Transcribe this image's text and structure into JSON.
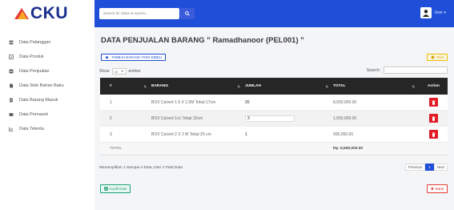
{
  "brand": {
    "logo_text": "CKU"
  },
  "topbar": {
    "search_placeholder": "Search for datas & reports...",
    "user_name": "User ▾"
  },
  "sidebar": {
    "items": [
      {
        "label": "Data Pelanggan",
        "icon": "table-icon"
      },
      {
        "label": "Data Produk",
        "icon": "box-icon"
      },
      {
        "label": "Data Penjualan",
        "icon": "cart-icon"
      },
      {
        "label": "Data Stok Bahan Baku",
        "icon": "file-icon"
      },
      {
        "label": "Data Barang Masuk",
        "icon": "inbox-icon"
      },
      {
        "label": "Data Pemasok",
        "icon": "truck-icon"
      },
      {
        "label": "Data Telenta",
        "icon": "chart-icon"
      }
    ]
  },
  "main": {
    "title": "DATA PENJUALAN BARANG \" Ramadhanoor (PEL001) \"",
    "add_button": "TAMBAH BARANG YANG DIBELI",
    "print_button": "Print",
    "show_label": "Show",
    "entries_value": "10",
    "entries_label": "entries",
    "search_label": "Search:",
    "columns": [
      "#",
      "BARANG",
      "JUMLAH",
      "TOTAL",
      "Action"
    ],
    "rows": [
      {
        "no": "1",
        "barang": "BOX Culvert 1.5 X 1.5M Tebal 17cm",
        "jumlah": "20",
        "total": "8,000,000.00"
      },
      {
        "no": "2",
        "barang": "BOX Culvert 1x1 Tebal 15cm",
        "jumlah": "3",
        "total": "1,050,000.00"
      },
      {
        "no": "3",
        "barang": "BOX Culvert 2 X 2 M Tebal 25 cm",
        "jumlah": "1",
        "total": "500,000.00"
      }
    ],
    "total_label": "TOTAL",
    "total_value": "Rp. 9,550,000.00",
    "info_text": "Menampilkan 1 Sampai 4 Data, Dari 4 Total Data",
    "pager": {
      "previous": "Previous",
      "page": "1",
      "next": "Next"
    },
    "confirm_button": "Konfirmasi",
    "cancel_button": "Batal"
  },
  "colors": {
    "topbar": "#1f4fd8",
    "table_header": "#262626",
    "delete": "#e01b24",
    "confirm": "#1aa37a",
    "print": "#f2b600"
  }
}
